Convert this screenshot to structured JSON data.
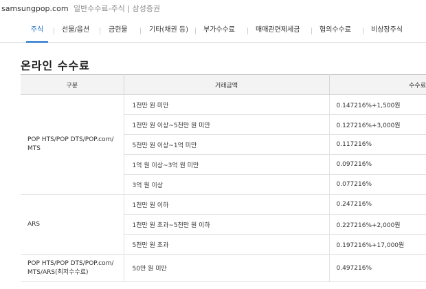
{
  "browser": {
    "host": "samsungpop.com",
    "path": "일반수수료-주식 | 삼성증권"
  },
  "tabs": [
    {
      "label": "주식",
      "active": true
    },
    {
      "label": "선물/옵션",
      "active": false
    },
    {
      "label": "금현물",
      "active": false
    },
    {
      "label": "기타(채권 등)",
      "active": false
    },
    {
      "label": "부가수수료",
      "active": false
    },
    {
      "label": "매매관련제세금",
      "active": false
    },
    {
      "label": "협의수수료",
      "active": false
    },
    {
      "label": "비상장주식",
      "active": false
    }
  ],
  "section_title": "온라인 수수료",
  "table": {
    "headers": {
      "category": "구분",
      "amount": "거래금액",
      "fee": "수수료"
    },
    "groups": [
      {
        "category_lines": [
          "POP HTS/POP DTS/POP.com/",
          "MTS"
        ],
        "rows": [
          {
            "amount": "1천만 원 미만",
            "fee": "0.147216%+1,500원"
          },
          {
            "amount": "1천만 원 이상~5천만 원 미만",
            "fee": "0.127216%+3,000원"
          },
          {
            "amount": "5천만 원 이상~1억 미만",
            "fee": "0.117216%"
          },
          {
            "amount": "1억 원 이상~3억 원 미만",
            "fee": "0.097216%"
          },
          {
            "amount": "3억 원 이상",
            "fee": "0.077216%"
          }
        ]
      },
      {
        "category_lines": [
          "ARS"
        ],
        "rows": [
          {
            "amount": "1천만 원 이하",
            "fee": "0.247216%"
          },
          {
            "amount": "1천만 원 초과~5천만 원 이하",
            "fee": "0.227216%+2,000원"
          },
          {
            "amount": "5천만 원 초과",
            "fee": "0.197216%+17,000원"
          }
        ]
      },
      {
        "category_lines": [
          "POP HTS/POP DTS/POP.com/",
          "MTS/ARS(최저수수료)"
        ],
        "rows": [
          {
            "amount": "50만 원 미만",
            "fee": "0.497216%"
          }
        ]
      }
    ]
  }
}
